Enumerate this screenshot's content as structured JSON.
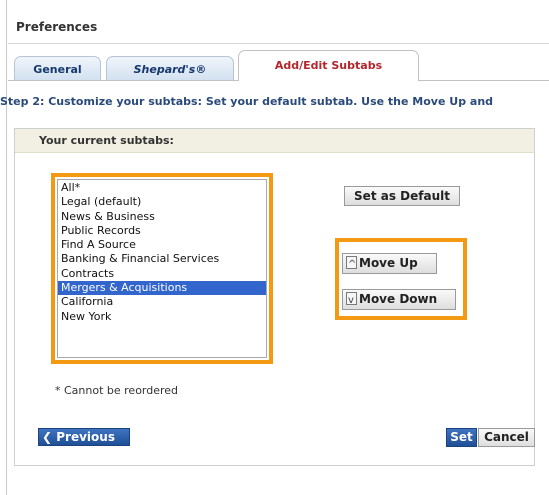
{
  "dialog": {
    "title": "Preferences"
  },
  "tabs": [
    {
      "label": "General",
      "active": false
    },
    {
      "label": "Shepard's®",
      "active": false
    },
    {
      "label": "Add/Edit Subtabs",
      "active": true
    }
  ],
  "step": {
    "text": "Step 2: Customize your subtabs: Set your default subtab. Use the Move Up and"
  },
  "panel": {
    "header": "Your current subtabs:",
    "subtabs": [
      "All*",
      "Legal (default)",
      "News & Business",
      "Public Records",
      "Find A Source",
      "Banking & Financial Services",
      "Contracts",
      "Mergers & Acquisitions",
      "California",
      "New York"
    ],
    "selected_subtab": "Mergers & Acquisitions",
    "note": "* Cannot be reordered"
  },
  "buttons": {
    "set_default": "Set as Default",
    "move_up": "Move Up",
    "move_down": "Move Down",
    "previous": "Previous",
    "set": "Set",
    "cancel": "Cancel"
  },
  "colors": {
    "highlight": "#f39a12",
    "selection": "#3366cc",
    "active_tab_text": "#b3262b",
    "primary_button": "#2a5ca8"
  }
}
